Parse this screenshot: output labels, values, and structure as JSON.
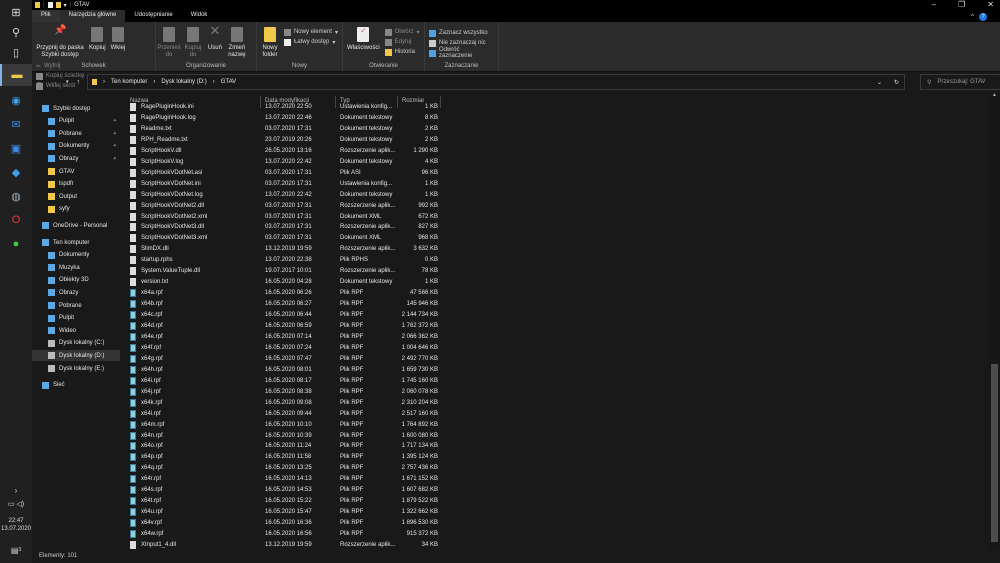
{
  "window": {
    "title": "GTAV",
    "tabs": [
      "Plik",
      "Narzędzia główne",
      "Udostępnianie",
      "Widok"
    ]
  },
  "ribbon": {
    "clipboard": {
      "pin": "Przypnij do paska Szybki dostęp",
      "copy": "Kopiuj",
      "paste": "Wklej",
      "cut": "Wytnij",
      "copy_path": "Kopiuj ścieżkę",
      "paste_shortcut": "Wklej skrót",
      "label": "Schowek"
    },
    "organize": {
      "move": "Przenieś do",
      "copy_to": "Kopiuj do",
      "delete": "Usuń",
      "rename": "Zmień nazwę",
      "label": "Organizowanie"
    },
    "new": {
      "new_folder": "Nowy folder",
      "new_item": "Nowy element",
      "easy_access": "Łatwy dostęp",
      "label": "Nowy"
    },
    "open": {
      "properties": "Właściwości",
      "open": "Otwórz",
      "edit": "Edytuj",
      "history": "Historia",
      "label": "Otwieranie"
    },
    "select": {
      "select_all": "Zaznacz wszystko",
      "select_none": "Nie zaznaczaj nic",
      "invert": "Odwróć zaznaczenie",
      "label": "Zaznaczanie"
    }
  },
  "address": {
    "crumbs": [
      "Ten komputer",
      "Dysk lokalny (D:)",
      "GTAV"
    ],
    "search_placeholder": "Przeszukaj: GTAV"
  },
  "nav": [
    {
      "label": "Szybki dostęp",
      "indent": 0
    },
    {
      "label": "Pulpit",
      "indent": 1,
      "pin": true
    },
    {
      "label": "Pobrane",
      "indent": 1,
      "pin": true
    },
    {
      "label": "Dokumenty",
      "indent": 1,
      "pin": true
    },
    {
      "label": "Obrazy",
      "indent": 1,
      "pin": true
    },
    {
      "label": "GTAV",
      "indent": 1
    },
    {
      "label": "lspdfr",
      "indent": 1
    },
    {
      "label": "Output",
      "indent": 1
    },
    {
      "label": "syfy",
      "indent": 1
    },
    {
      "label": "OneDrive - Personal",
      "indent": 0,
      "gap": true
    },
    {
      "label": "Ten komputer",
      "indent": 0,
      "gap": true
    },
    {
      "label": "Dokumenty",
      "indent": 1
    },
    {
      "label": "Muzyka",
      "indent": 1
    },
    {
      "label": "Obiekty 3D",
      "indent": 1
    },
    {
      "label": "Obrazy",
      "indent": 1
    },
    {
      "label": "Pobrane",
      "indent": 1
    },
    {
      "label": "Pulpit",
      "indent": 1
    },
    {
      "label": "Wideo",
      "indent": 1
    },
    {
      "label": "Dysk lokalny (C:)",
      "indent": 1
    },
    {
      "label": "Dysk lokalny (D:)",
      "indent": 1,
      "selected": true
    },
    {
      "label": "Dysk lokalny (E:)",
      "indent": 1
    },
    {
      "label": "Sieć",
      "indent": 0,
      "gap": true
    }
  ],
  "columns": [
    "Nazwa",
    "Data modyfikacji",
    "Typ",
    "Rozmiar"
  ],
  "files": [
    [
      "RagePluginHook.ini",
      "13.07.2020 22:50",
      "Ustawienia konfig...",
      "1 KB"
    ],
    [
      "RagePluginHook.log",
      "13.07.2020 22:46",
      "Dokument tekstowy",
      "8 KB"
    ],
    [
      "Readme.txt",
      "03.07.2020 17:31",
      "Dokument tekstowy",
      "2 KB"
    ],
    [
      "RPH_Readme.txt",
      "23.07.2019 20:26",
      "Dokument tekstowy",
      "2 KB"
    ],
    [
      "ScriptHookV.dll",
      "26.05.2020 13:16",
      "Rozszerzenie aplik...",
      "1 290 KB"
    ],
    [
      "ScriptHookV.log",
      "13.07.2020 22:42",
      "Dokument tekstowy",
      "4 KB"
    ],
    [
      "ScriptHookVDotNet.asi",
      "03.07.2020 17:31",
      "Plik ASI",
      "96 KB"
    ],
    [
      "ScriptHookVDotNet.ini",
      "03.07.2020 17:31",
      "Ustawienia konfig...",
      "1 KB"
    ],
    [
      "ScriptHookVDotNet.log",
      "13.07.2020 22:42",
      "Dokument tekstowy",
      "1 KB"
    ],
    [
      "ScriptHookVDotNet2.dll",
      "03.07.2020 17:31",
      "Rozszerzenie aplik...",
      "992 KB"
    ],
    [
      "ScriptHookVDotNet2.xml",
      "03.07.2020 17:31",
      "Dokument XML",
      "672 KB"
    ],
    [
      "ScriptHookVDotNet3.dll",
      "03.07.2020 17:31",
      "Rozszerzenie aplik...",
      "827 KB"
    ],
    [
      "ScriptHookVDotNet3.xml",
      "03.07.2020 17:31",
      "Dokument XML",
      "968 KB"
    ],
    [
      "SlimDX.dll",
      "13.12.2019 19:59",
      "Rozszerzenie aplik...",
      "3 632 KB"
    ],
    [
      "startup.rphs",
      "13.07.2020 22:38",
      "Plik RPHS",
      "0 KB"
    ],
    [
      "System.ValueTuple.dll",
      "19.07.2017 10:01",
      "Rozszerzenie aplik...",
      "78 KB"
    ],
    [
      "version.txt",
      "16.05.2020 04:28",
      "Dokument tekstowy",
      "1 KB"
    ],
    [
      "x64a.rpf",
      "16.05.2020 06:26",
      "Plik RPF",
      "47 566 KB"
    ],
    [
      "x64b.rpf",
      "16.05.2020 06:27",
      "Plik RPF",
      "145 946 KB"
    ],
    [
      "x64c.rpf",
      "16.05.2020 06:44",
      "Plik RPF",
      "2 144 734 KB"
    ],
    [
      "x64d.rpf",
      "16.05.2020 06:59",
      "Plik RPF",
      "1 762 372 KB"
    ],
    [
      "x64e.rpf",
      "16.05.2020 07:14",
      "Plik RPF",
      "2 066 362 KB"
    ],
    [
      "x64f.rpf",
      "16.05.2020 07:24",
      "Plik RPF",
      "1 004 646 KB"
    ],
    [
      "x64g.rpf",
      "16.05.2020 07:47",
      "Plik RPF",
      "2 492 770 KB"
    ],
    [
      "x64h.rpf",
      "16.05.2020 08:01",
      "Plik RPF",
      "1 659 730 KB"
    ],
    [
      "x64i.rpf",
      "16.05.2020 08:17",
      "Plik RPF",
      "1 745 160 KB"
    ],
    [
      "x64j.rpf",
      "16.05.2020 08:38",
      "Plik RPF",
      "2 060 078 KB"
    ],
    [
      "x64k.rpf",
      "16.05.2020 09:08",
      "Plik RPF",
      "2 310 204 KB"
    ],
    [
      "x64l.rpf",
      "16.05.2020 09:44",
      "Plik RPF",
      "2 517 160 KB"
    ],
    [
      "x64m.rpf",
      "16.05.2020 10:10",
      "Plik RPF",
      "1 764 892 KB"
    ],
    [
      "x64n.rpf",
      "16.05.2020 10:39",
      "Plik RPF",
      "1 600 080 KB"
    ],
    [
      "x64o.rpf",
      "16.05.2020 11:24",
      "Plik RPF",
      "1 717 134 KB"
    ],
    [
      "x64p.rpf",
      "16.05.2020 11:58",
      "Plik RPF",
      "1 395 124 KB"
    ],
    [
      "x64q.rpf",
      "16.05.2020 13:25",
      "Plik RPF",
      "2 757 436 KB"
    ],
    [
      "x64r.rpf",
      "16.05.2020 14:13",
      "Plik RPF",
      "1 671 152 KB"
    ],
    [
      "x64s.rpf",
      "16.05.2020 14:53",
      "Plik RPF",
      "1 607 682 KB"
    ],
    [
      "x64t.rpf",
      "16.05.2020 15:22",
      "Plik RPF",
      "1 879 522 KB"
    ],
    [
      "x64u.rpf",
      "16.05.2020 15:47",
      "Plik RPF",
      "1 322 662 KB"
    ],
    [
      "x64v.rpf",
      "16.05.2020 16:36",
      "Plik RPF",
      "1 896 530 KB"
    ],
    [
      "x64w.rpf",
      "16.05.2020 16:56",
      "Plik RPF",
      "915 372 KB"
    ],
    [
      "XInput1_4.dll",
      "13.12.2019 19:59",
      "Rozszerzenie aplik...",
      "34 KB"
    ]
  ],
  "status": {
    "count": "Elementy: 101"
  },
  "tray": {
    "time": "22:47",
    "date": "13.07.2020",
    "notifications": "3"
  }
}
